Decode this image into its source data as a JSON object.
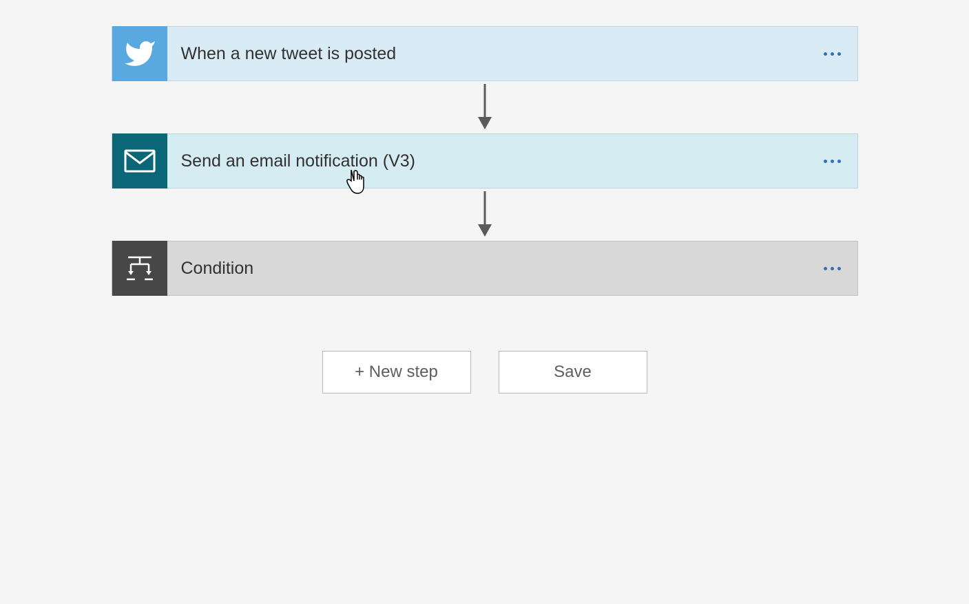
{
  "steps": {
    "twitter": {
      "label": "When a new tweet is posted"
    },
    "email": {
      "label": "Send an email notification (V3)"
    },
    "condition": {
      "label": "Condition"
    }
  },
  "buttons": {
    "newStep": "+ New step",
    "save": "Save"
  }
}
